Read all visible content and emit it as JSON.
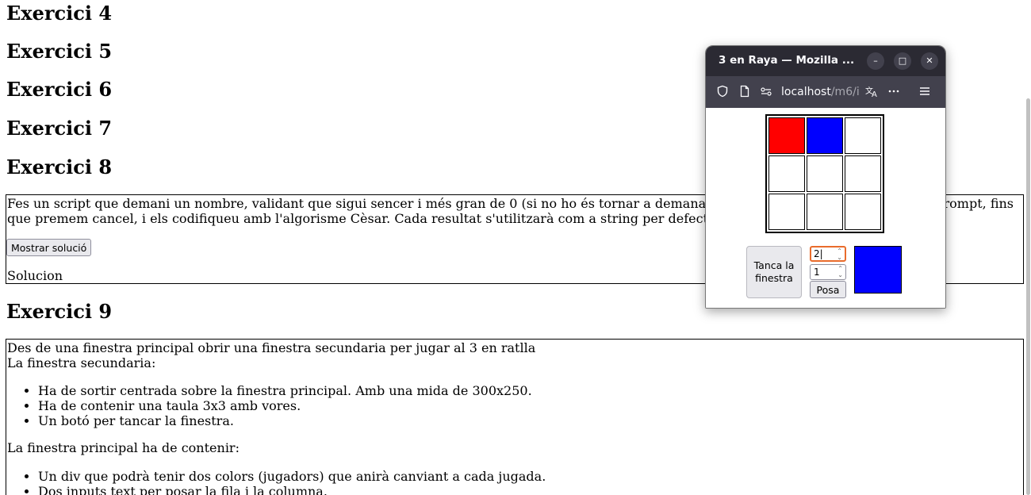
{
  "headings": {
    "ex4": "Exercici 4",
    "ex5": "Exercici 5",
    "ex6": "Exercici 6",
    "ex7": "Exercici 7",
    "ex8": "Exercici 8",
    "ex9": "Exercici 9"
  },
  "ex8": {
    "line1_left": "Fes un script que demani un nombre, validant que sigui sencer i més gran de 0 (si no ho és tornar a demana",
    "line1_right": "rompt, fins",
    "line2": "que premem cancel, i els codifiqueu amb l'algorisme Cèsar. Cada resultat s'utilitzarà com a string per defect",
    "button": "Mostrar solució",
    "result": "Solucion"
  },
  "ex9": {
    "line1": "Des de una finestra principal obrir una finestra secundaria per jugar al 3 en ratlla",
    "line2": "La finestra secundaria:",
    "list1": [
      "Ha de sortir centrada sobre la finestra principal. Amb una mida de 300x250.",
      "Ha de contenir una taula 3x3 amb vores.",
      "Un botó per tancar la finestra."
    ],
    "line3": "La finestra principal ha de contenir:",
    "list2": [
      "Un div que podrà tenir dos colors (jugadors) que anirà canviant a cada jugada.",
      "Dos inputs text per posar la fila i la columna."
    ]
  },
  "popup": {
    "title": "3 en Raya — Mozilla ...",
    "url_main": "localhost",
    "url_rest": "/m6/i",
    "minimize": "–",
    "maximize": "□",
    "close": "✕",
    "board_colors": [
      [
        "#ff0000",
        "#0000ff",
        "#ffffff"
      ],
      [
        "#ffffff",
        "#ffffff",
        "#ffffff"
      ],
      [
        "#ffffff",
        "#ffffff",
        "#ffffff"
      ]
    ],
    "close_button": "Tanca la finestra",
    "row_value": "2",
    "col_value": "1",
    "posa_button": "Posa",
    "player_color": "#0000ff"
  }
}
